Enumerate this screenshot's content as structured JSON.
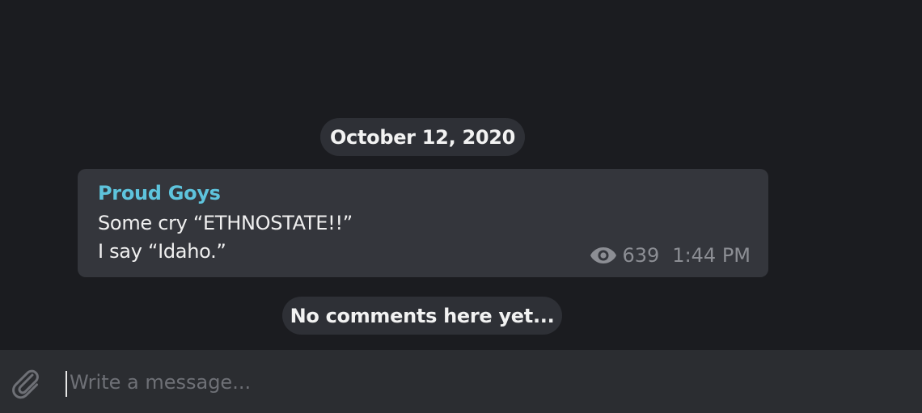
{
  "chat": {
    "date_label": "October 12, 2020",
    "message": {
      "sender": "Proud Goys",
      "lines": [
        "Some cry “ETHNOSTATE!!”",
        "I say “Idaho.”"
      ],
      "views": "639",
      "time": "1:44 PM"
    },
    "comments_label": "No comments here yet..."
  },
  "composer": {
    "placeholder": "Write a message..."
  },
  "icons": {
    "views": "eye-icon",
    "attach": "paperclip-icon"
  },
  "colors": {
    "background": "#1b1c20",
    "bubble": "#34363c",
    "pill": "#2e3036",
    "sender": "#5ec4dd",
    "meta": "#8c8e94",
    "composer": "#2b2d31"
  }
}
